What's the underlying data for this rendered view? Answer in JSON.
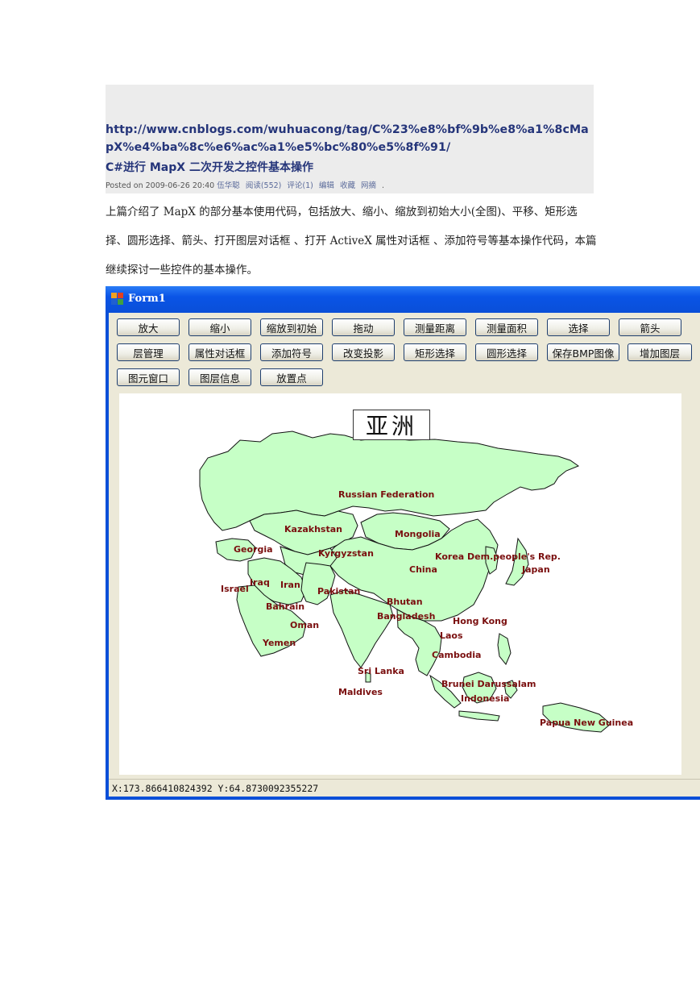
{
  "post": {
    "url": "http://www.cnblogs.com/wuhuacong/tag/C%23%e8%bf%9b%e8%a1%8cMapX%e4%ba%8c%e6%ac%a1%e5%bc%80%e5%8f%91/",
    "title": "C#进行 MapX 二次开发之控件基本操作",
    "meta_posted": "Posted on 2009-06-26 20:40",
    "meta_author": "伍华聪",
    "meta_reads": "阅读(552)",
    "meta_comments": "评论(1)",
    "meta_edit": "编辑",
    "meta_fav": "收藏",
    "meta_pick": "网摘",
    "meta_end": ".",
    "intro": "上篇介绍了 MapX 的部分基本使用代码，包括放大、缩小、缩放到初始大小(全图)、平移、矩形选择、圆形选择、箭头、打开图层对话框 、打开 ActiveX 属性对话框 、添加符号等基本操作代码，本篇继续探讨一些控件的基本操作。"
  },
  "form": {
    "title": "Form1",
    "buttons_row1": [
      "放大",
      "缩小",
      "缩放到初始",
      "拖动",
      "测量距离",
      "测量面积",
      "选择",
      "箭头"
    ],
    "buttons_row2": [
      "层管理",
      "属性对话框",
      "添加符号",
      "改变投影",
      "矩形选择",
      "圆形选择",
      "保存BMP图像",
      "增加图层"
    ],
    "buttons_row3": [
      "图元窗口",
      "图层信息",
      "放置点"
    ],
    "status": "X:173.866410824392 Y:64.8730092355227"
  },
  "map": {
    "title": "亚洲",
    "labels": [
      "Russian Federation",
      "Kazakhstan",
      "Mongolia",
      "Georgia",
      "Kyrgyzstan",
      "Korea Dem.people's Rep.",
      "Japan",
      "China",
      "Iraq",
      "Iran",
      "Israel",
      "Pakistan",
      "Bahrain",
      "Bhutan",
      "Bangladesh",
      "Hong Kong",
      "Oman",
      "Laos",
      "Yemen",
      "Cambodia",
      "Sri Lanka",
      "Maldives",
      "Brunei Darussalam",
      "Indonesia",
      "Papua New Guinea"
    ],
    "land_color": "#c6ffc6",
    "label_color": "#7a0f0f"
  }
}
